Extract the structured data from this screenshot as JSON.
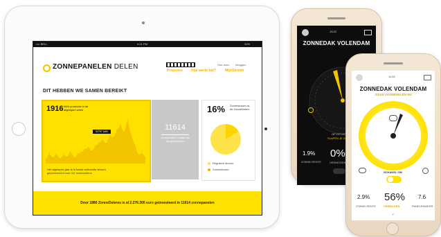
{
  "ipad": {
    "status": {
      "carrier": "•••• BELL",
      "time": "4:21 PM",
      "battery": "22%"
    },
    "brand": {
      "bold": "ZONNEPANELEN",
      "light": "DELEN"
    },
    "nav": {
      "top_items": [
        "Hoe doen",
        "Inloggen"
      ],
      "items": [
        "Projecten",
        "Hoe werkt het?",
        "MijnStroom"
      ]
    },
    "section_title": "DIT HEBBEN WE SAMEN BEREIKT",
    "production_card": {
      "value": "1916",
      "label": "kWh productie in de afgelopen week",
      "tooltip": "92757 kWh",
      "footer": "Het afgelopen jaar is in totaal voldoende stroom geproduceerd voor 111 huishoudens"
    },
    "panels_card": {
      "value": "11614",
      "label": "zonnepanelen in totaal van ons geïnvesteerd"
    },
    "share_card": {
      "value": "16%",
      "label": "Zonnestroom ta. de ZonneDelers",
      "legend": [
        "Reguliere stroom",
        "Zonnestroom"
      ]
    },
    "banner": "Door 1880 ZonneDeleres is al 2.276.300 euro geïnvesteerd in 11614 zonnepanelen"
  },
  "phone_back": {
    "time": "13:22",
    "title": "ZONNEDAK VOLENDAM",
    "gauge_note_1": "OP DIT MOMENT",
    "gauge_note_2": "SLAPEN JE ZONNEPANE",
    "rate_value": "1.9%",
    "rate_label": "ZONNE-RENTE",
    "power_value": "0%",
    "power_label": "VERMOGEN"
  },
  "phone_front": {
    "time": "11:02",
    "title": "ZONNEDAK VOLENDAM",
    "subtitle": "JOUW ZONNEDELEN NU",
    "toggle_label": "SCHAKEL OM",
    "rate_value": "2.9%",
    "rate_label": "ZONNE-RENTE",
    "power_value": "56%",
    "power_label": "VERMOGEN",
    "panels_value": "7.6",
    "panels_label": "PANELENWEER"
  },
  "colors": {
    "accent": "#ffe100",
    "accent_dark": "#f2b000",
    "dark": "#111111"
  },
  "chart_data": {
    "type": "area",
    "title": "",
    "xlabel": "",
    "ylabel": "",
    "x": [
      1,
      2,
      3,
      4,
      5,
      6,
      7,
      8,
      9,
      10,
      11,
      12,
      13,
      14,
      15,
      16,
      17,
      18,
      19,
      20,
      21,
      22,
      23,
      24,
      25,
      26,
      27,
      28,
      29
    ],
    "values": [
      8,
      22,
      12,
      20,
      10,
      18,
      14,
      26,
      12,
      20,
      24,
      30,
      34,
      26,
      38,
      44,
      50,
      42,
      60,
      55,
      70,
      82,
      66,
      92,
      60,
      40,
      18,
      22,
      14
    ],
    "ylim": [
      0,
      100
    ],
    "grid": false,
    "legend": "none"
  }
}
